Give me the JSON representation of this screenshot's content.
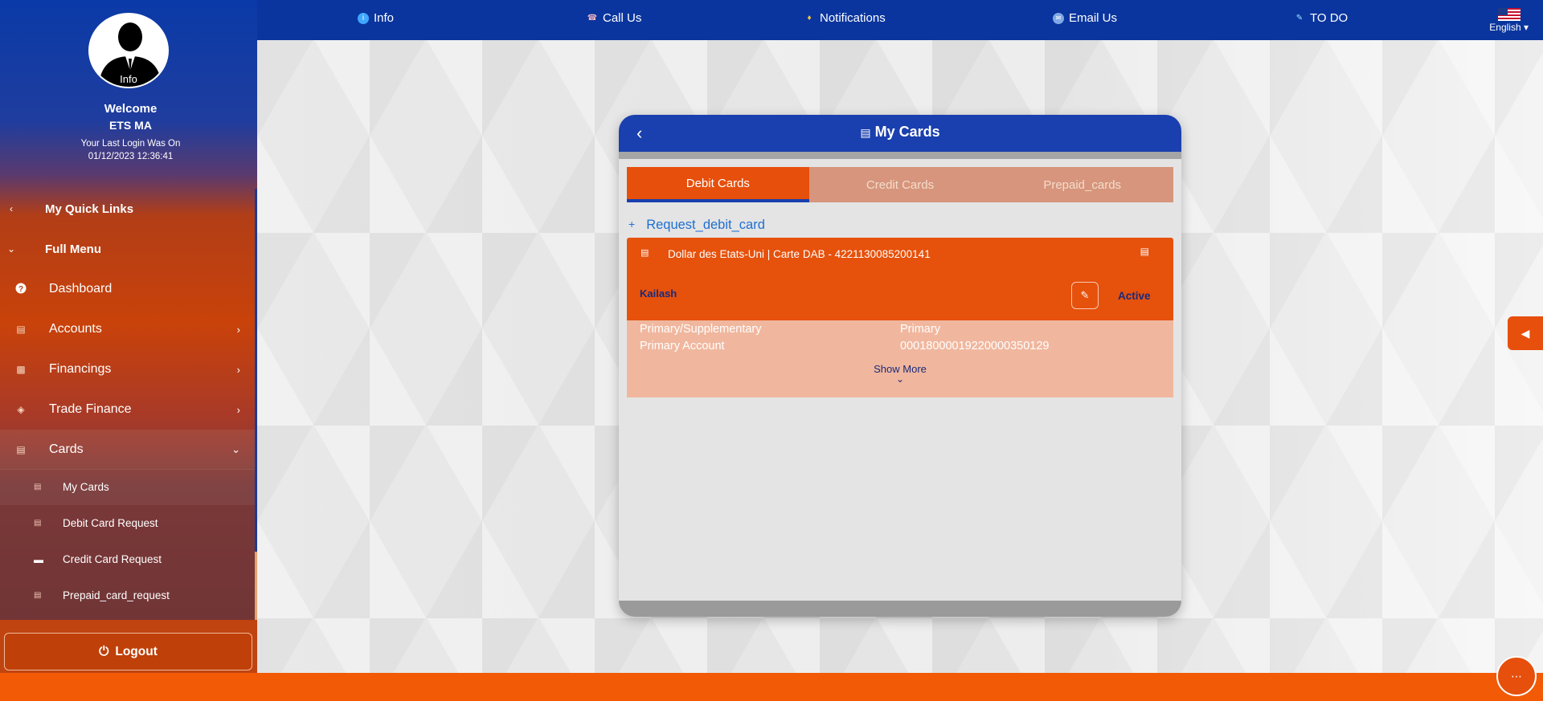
{
  "sidebar": {
    "avatar_label": "Info",
    "welcome": "Welcome",
    "username": "ETS MA",
    "last_login_label": "Your Last Login Was On",
    "last_login_value": "01/12/2023 12:36:41",
    "quick_links": "My Quick Links",
    "full_menu": "Full Menu",
    "items": [
      {
        "label": "Dashboard",
        "icon": "help-circle-icon"
      },
      {
        "label": "Accounts",
        "icon": "accounts-icon"
      },
      {
        "label": "Financings",
        "icon": "chart-icon"
      },
      {
        "label": "Trade Finance",
        "icon": "trade-icon"
      },
      {
        "label": "Cards",
        "icon": "card-icon"
      }
    ],
    "sub_items": [
      {
        "label": "My Cards",
        "icon": "card-icon"
      },
      {
        "label": "Debit Card Request",
        "icon": "card-icon"
      },
      {
        "label": "Credit Card Request",
        "icon": "credit-card-icon"
      },
      {
        "label": "Prepaid_card_request",
        "icon": "card-icon"
      }
    ],
    "logout": "Logout"
  },
  "topbar": {
    "info": "Info",
    "call_us": "Call Us",
    "notifications": "Notifications",
    "email_us": "Email Us",
    "todo": "TO DO",
    "language": "English"
  },
  "panel": {
    "title": "My Cards",
    "tabs": [
      {
        "label": "Debit Cards"
      },
      {
        "label": "Credit Cards"
      },
      {
        "label": "Prepaid_cards"
      }
    ],
    "request_link": "Request_debit_card",
    "card": {
      "name": "Dollar des Etats-Uni | Carte DAB - 4221130085200141",
      "holder": "Kailash",
      "status": "Active",
      "details": [
        {
          "label": "Primary/Supplementary",
          "value": "Primary"
        },
        {
          "label": "Primary Account",
          "value": "00018000019220000350129"
        }
      ],
      "show_more": "Show More"
    }
  },
  "colors": {
    "primary_blue": "#0a359e",
    "accent_orange": "#e64f0c",
    "link_blue": "#1f6fd1"
  }
}
